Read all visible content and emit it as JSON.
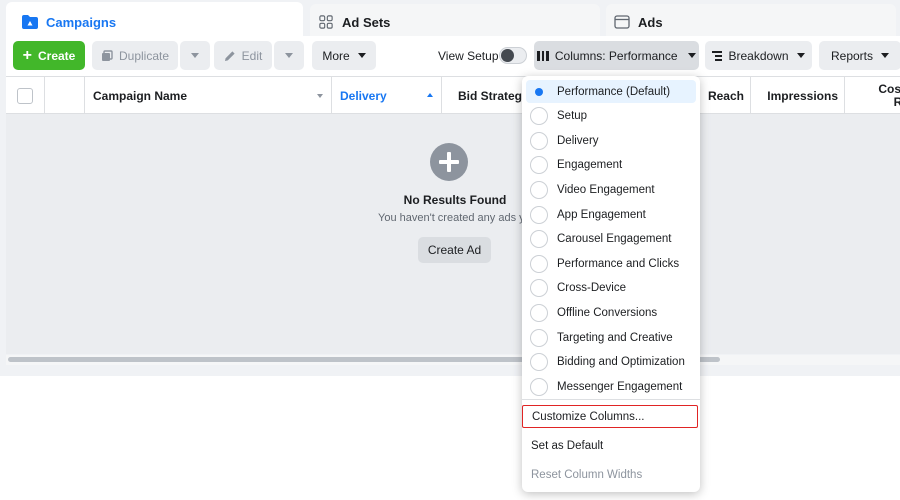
{
  "tabs": {
    "campaigns": "Campaigns",
    "ad_sets": "Ad Sets",
    "ads": "Ads"
  },
  "toolbar": {
    "create": "Create",
    "duplicate": "Duplicate",
    "edit": "Edit",
    "more": "More",
    "view_setup": "View Setup",
    "columns": "Columns: Performance",
    "breakdown": "Breakdown",
    "reports": "Reports",
    "view_setup_enabled": false
  },
  "table": {
    "headers": {
      "campaign_name": "Campaign Name",
      "delivery": "Delivery",
      "bid_strategy": "Bid Strategy",
      "reach": "Reach",
      "impressions": "Impressions",
      "cost_line1": "Cost",
      "cost_line2": "Re"
    },
    "empty": {
      "title": "No Results Found",
      "subtitle": "You haven't created any ads ye",
      "button": "Create Ad"
    }
  },
  "columns_menu": {
    "presets": [
      "Performance (Default)",
      "Setup",
      "Delivery",
      "Engagement",
      "Video Engagement",
      "App Engagement",
      "Carousel Engagement",
      "Performance and Clicks",
      "Cross-Device",
      "Offline Conversions",
      "Targeting and Creative",
      "Bidding and Optimization",
      "Messenger Engagement"
    ],
    "selected_index": 0,
    "customize": "Customize Columns...",
    "set_default": "Set as Default",
    "reset_widths": "Reset Column Widths"
  },
  "colors": {
    "accent_blue": "#1877f2",
    "create_green": "#42b72a",
    "highlight_red": "#e02424"
  }
}
